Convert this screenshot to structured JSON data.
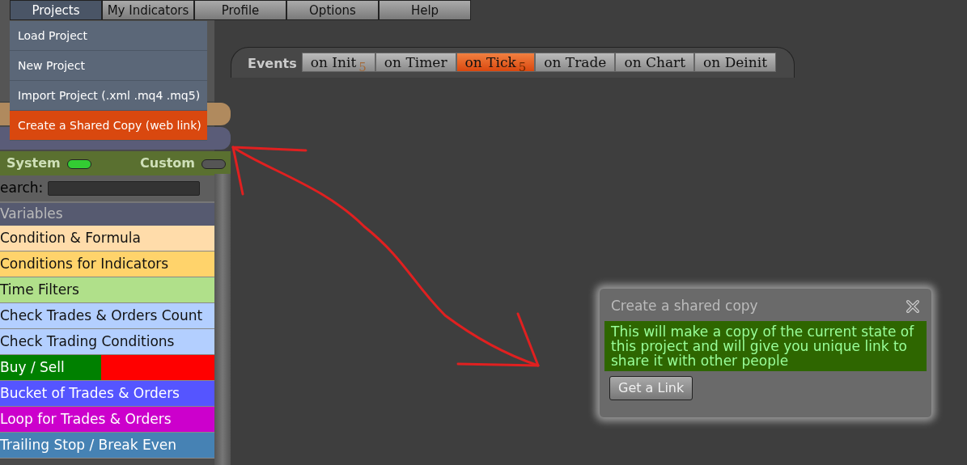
{
  "menu_bar": [
    {
      "label": "Projects",
      "selected": true
    },
    {
      "label": "My Indicators",
      "selected": false
    },
    {
      "label": "Profile",
      "selected": false
    },
    {
      "label": "Options",
      "selected": false
    },
    {
      "label": "Help",
      "selected": false
    }
  ],
  "dropdown": [
    {
      "label": "Load Project",
      "highlighted": false
    },
    {
      "label": "New Project",
      "highlighted": false
    },
    {
      "label": "Import Project (.xml .mq4 .mq5)",
      "highlighted": false
    },
    {
      "label": "Create a Shared Copy (web link)",
      "highlighted": true
    }
  ],
  "sidebar": {
    "toggles": [
      {
        "label": "System",
        "on": true
      },
      {
        "label": "Custom",
        "on": false
      }
    ],
    "search": {
      "label": "earch:"
    },
    "header": "Variables",
    "blocks": [
      {
        "label": "Condition & Formula",
        "color": "#ffdcaa",
        "kind": "plain"
      },
      {
        "label": "Conditions for Indicators",
        "color": "#ffd36b",
        "kind": "plain"
      },
      {
        "label": "Time Filters",
        "color": "#b0e08a",
        "kind": "plain"
      },
      {
        "label": "Check Trades & Orders Count",
        "color": "#b3cfff",
        "kind": "plain"
      },
      {
        "label": "Check Trading Conditions",
        "color": "#b3cfff",
        "kind": "plain"
      },
      {
        "label": "Buy / Sell",
        "color": "#008000",
        "kind": "split"
      },
      {
        "label": "Bucket of Trades & Orders",
        "color": "#5555ff",
        "kind": "plain"
      },
      {
        "label": "Loop for Trades & Orders",
        "color": "#cc00cc",
        "kind": "plain"
      },
      {
        "label": "Trailing Stop / Break Even",
        "color": "#4682b4",
        "kind": "plain"
      }
    ]
  },
  "events": {
    "label": "Events",
    "tabs": [
      {
        "label": "on Init",
        "badge": "5",
        "selected": false
      },
      {
        "label": "on Timer",
        "selected": false
      },
      {
        "label": "on Tick",
        "badge": "5",
        "selected": true
      },
      {
        "label": "on Trade",
        "selected": false
      },
      {
        "label": "on Chart",
        "selected": false
      },
      {
        "label": "on Deinit",
        "selected": false
      }
    ]
  },
  "dialog": {
    "title": "Create a shared copy",
    "message": "This will make a copy of the current state of this project and will give you unique link to share it with other people",
    "button": "Get a Link"
  }
}
